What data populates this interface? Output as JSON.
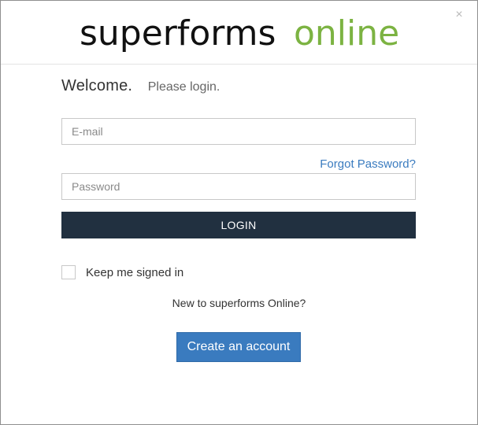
{
  "dialog": {
    "close_symbol": "×",
    "logo": {
      "part1": "superforms",
      "part2": "online",
      "color_dark": "#111111",
      "color_accent": "#7cb342"
    }
  },
  "welcome": {
    "title": "Welcome.",
    "subtitle": "Please login."
  },
  "form": {
    "email_placeholder": "E-mail",
    "password_placeholder": "Password",
    "forgot_password": "Forgot Password?",
    "login_button": "LOGIN",
    "keep_signed_in": "Keep me signed in",
    "keep_signed_in_checked": false
  },
  "signup": {
    "prompt": "New to superforms Online?",
    "create_button": "Create an account"
  },
  "colors": {
    "login_button_bg": "#213040",
    "primary_blue": "#3a7bbf"
  }
}
